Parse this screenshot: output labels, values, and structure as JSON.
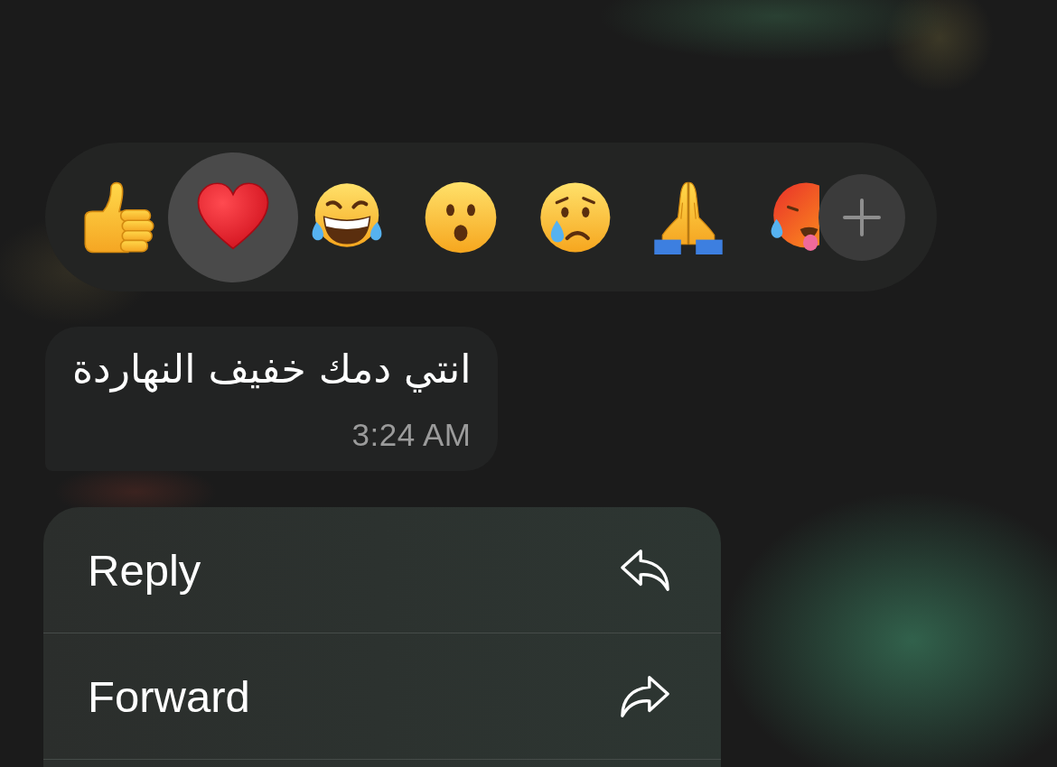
{
  "reactions": [
    {
      "kind": "thumbs_up",
      "selected": false
    },
    {
      "kind": "heart",
      "selected": true
    },
    {
      "kind": "tears_of_joy",
      "selected": false
    },
    {
      "kind": "surprised",
      "selected": false
    },
    {
      "kind": "crying",
      "selected": false
    },
    {
      "kind": "praying",
      "selected": false
    },
    {
      "kind": "hot_face",
      "selected": false
    }
  ],
  "message": {
    "text": "انتي دمك خفيف النهاردة",
    "time": "3:24 AM"
  },
  "menu": [
    {
      "kind": "reply",
      "label": "Reply"
    },
    {
      "kind": "forward",
      "label": "Forward"
    }
  ]
}
